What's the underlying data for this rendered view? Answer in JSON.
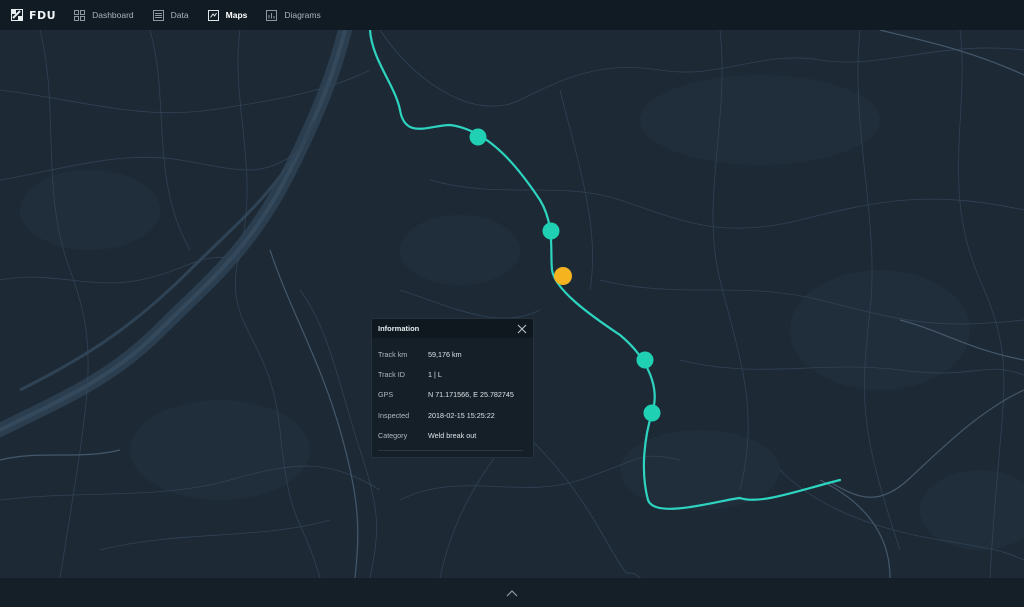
{
  "app": {
    "brand": "FDU"
  },
  "nav": {
    "items": [
      {
        "label": "Dashboard",
        "icon": "grid-icon",
        "active": false
      },
      {
        "label": "Data",
        "icon": "list-icon",
        "active": false
      },
      {
        "label": "Maps",
        "icon": "map-icon",
        "active": true
      },
      {
        "label": "Diagrams",
        "icon": "bar-chart-icon",
        "active": false
      }
    ]
  },
  "colors": {
    "track": "#2dd4bf",
    "marker": "#1fd1b2",
    "marker_selected": "#f5b320",
    "background": "#1d2a36",
    "topbar": "#111b23"
  },
  "map": {
    "markers": [
      {
        "status": "normal"
      },
      {
        "status": "normal"
      },
      {
        "status": "selected"
      },
      {
        "status": "normal"
      },
      {
        "status": "normal"
      }
    ]
  },
  "info": {
    "title": "Information",
    "rows": [
      {
        "key": "Track km",
        "value": "59,176 km"
      },
      {
        "key": "Track ID",
        "value": "1 | L"
      },
      {
        "key": "GPS",
        "value": "N 71.171566, E 25.782745"
      },
      {
        "key": "Inspected",
        "value": "2018-02-15 15:25:22"
      },
      {
        "key": "Category",
        "value": "Weld break out"
      }
    ]
  },
  "footer": {
    "expand_icon": "chevron-up-icon"
  }
}
